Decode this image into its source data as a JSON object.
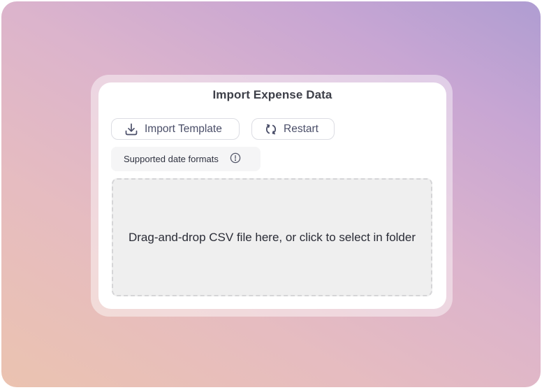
{
  "dialog": {
    "title": "Import Expense Data"
  },
  "toolbar": {
    "import_template_label": "Import Template",
    "import_template_icon": "download-icon",
    "restart_label": "Restart",
    "restart_icon": "refresh-icon"
  },
  "formats": {
    "label": "Supported date formats",
    "icon": "info-icon"
  },
  "dropzone": {
    "text": "Drag-and-drop CSV file here, or click to select in folder"
  },
  "colors": {
    "background_gradient": [
      "#ebc3b0",
      "#dcb4cc",
      "#af9dd2"
    ],
    "card": "#ffffff",
    "dropzone": "#efefef",
    "text": "#3d3f48",
    "button_text": "#4a4e68"
  }
}
